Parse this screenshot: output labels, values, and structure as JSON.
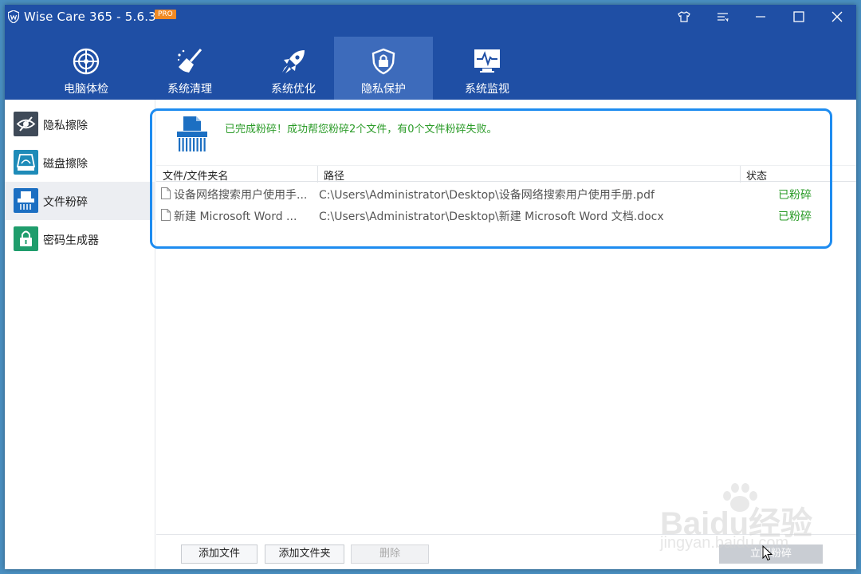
{
  "app": {
    "title": "Wise Care 365 - 5.6.3",
    "badge": "PRO",
    "accent": "#1f4fa5"
  },
  "window_controls": [
    "shirt-icon",
    "menu-icon",
    "minimize-icon",
    "maximize-icon",
    "close-icon"
  ],
  "nav": [
    {
      "label": "电脑体检",
      "icon": "checkup-icon",
      "active": false
    },
    {
      "label": "系统清理",
      "icon": "broom-icon",
      "active": false
    },
    {
      "label": "系统优化",
      "icon": "rocket-icon",
      "active": false
    },
    {
      "label": "隐私保护",
      "icon": "shield-lock-icon",
      "active": true
    },
    {
      "label": "系统监视",
      "icon": "monitor-icon",
      "active": false
    }
  ],
  "sidebar": {
    "items": [
      {
        "label": "隐私擦除",
        "icon": "eye-slash-icon",
        "color": "#3f4a58",
        "active": false
      },
      {
        "label": "磁盘擦除",
        "icon": "disk-icon",
        "color": "#1e8bb8",
        "active": false
      },
      {
        "label": "文件粉碎",
        "icon": "shredder-icon",
        "color": "#1c6fc2",
        "active": true
      },
      {
        "label": "密码生成器",
        "icon": "lock-icon",
        "color": "#1f9d6c",
        "active": false
      }
    ]
  },
  "result": {
    "message": "已完成粉碎！成功帮您粉碎2个文件，有0个文件粉碎失败。",
    "color": "#2a9b27"
  },
  "table": {
    "headers": {
      "name": "文件/文件夹名",
      "path": "路径",
      "status": "状态"
    },
    "rows": [
      {
        "name": "设备网络搜索用户使用手...",
        "path": "C:\\Users\\Administrator\\Desktop\\设备网络搜索用户使用手册.pdf",
        "status": "已粉碎"
      },
      {
        "name": "新建 Microsoft Word ...",
        "path": "C:\\Users\\Administrator\\Desktop\\新建 Microsoft Word 文档.docx",
        "status": "已粉碎"
      }
    ]
  },
  "buttons": {
    "add_file": "添加文件",
    "add_folder": "添加文件夹",
    "delete": "删除",
    "shred_now": "立即粉碎"
  },
  "watermark": {
    "line1": "Baidu经验",
    "line2": "jingyan.baidu.com"
  }
}
